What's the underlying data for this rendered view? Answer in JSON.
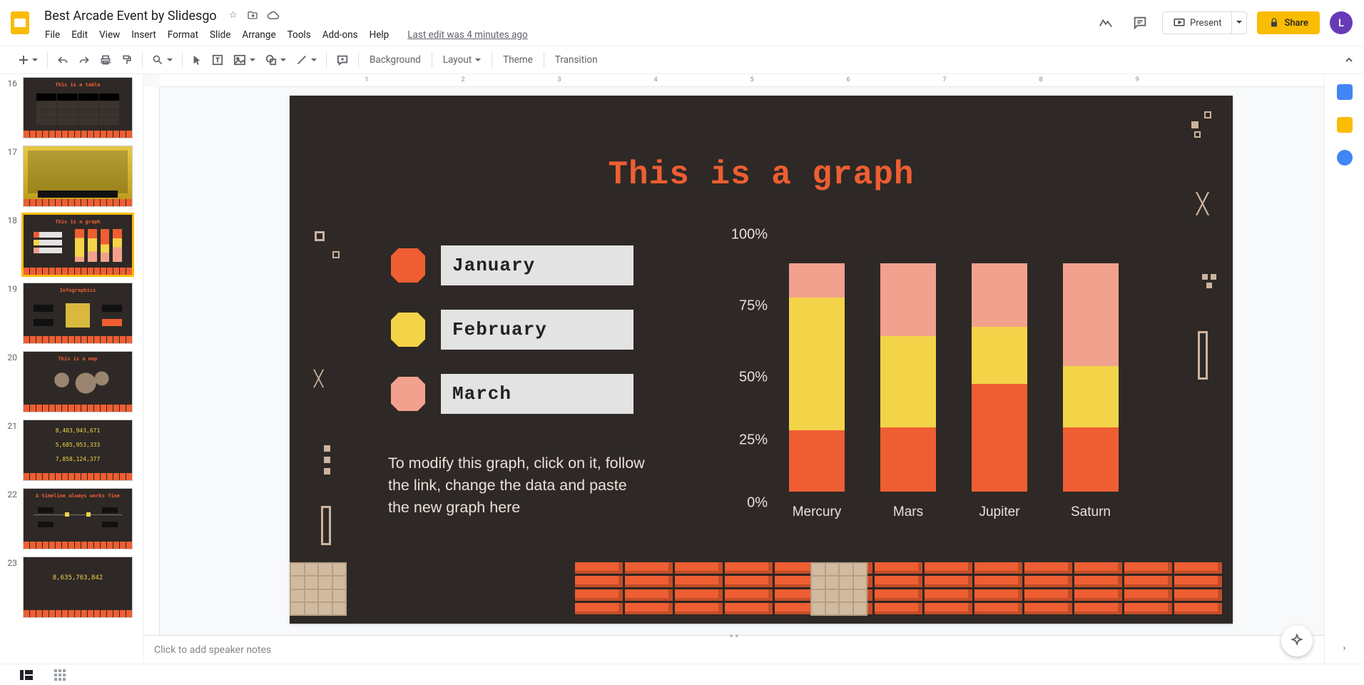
{
  "doc": {
    "name": "Best Arcade Event by Slidesgo",
    "lastEdit": "Last edit was 4 minutes ago",
    "avatarLetter": "L"
  },
  "menu": {
    "file": "File",
    "edit": "Edit",
    "view": "View",
    "insert": "Insert",
    "format": "Format",
    "slide": "Slide",
    "arrange": "Arrange",
    "tools": "Tools",
    "addons": "Add-ons",
    "help": "Help"
  },
  "actions": {
    "present": "Present",
    "share": "Share"
  },
  "toolbar": {
    "background": "Background",
    "layout": "Layout",
    "theme": "Theme",
    "transition": "Transition"
  },
  "filmstrip": {
    "numbers": [
      "16",
      "17",
      "18",
      "19",
      "20",
      "21",
      "22",
      "23"
    ],
    "selectedIndex": 2,
    "thumbTitle16": "This is a table",
    "thumbTitle18": "This is a graph",
    "thumbTitle19": "Infographics",
    "thumbTitle20": "This is a map",
    "thumbTitle22": "A timeline always works fine",
    "thumb21a": "8,403,943,671",
    "thumb21b": "5,685,953,333",
    "thumb21c": "7,858,124,377",
    "thumb23a": "8,635,763,842"
  },
  "slide": {
    "title": "This is a graph",
    "note": "To modify this graph, click on it, follow the link, change the data and paste the new graph here",
    "legend": {
      "jan": "January",
      "feb": "February",
      "mar": "March"
    }
  },
  "chart_data": {
    "type": "bar",
    "stacked": true,
    "ylim": [
      0,
      100
    ],
    "yticks": [
      "0%",
      "25%",
      "50%",
      "75%",
      "100%"
    ],
    "categories": [
      "Mercury",
      "Mars",
      "Jupiter",
      "Saturn"
    ],
    "series": [
      {
        "name": "January",
        "color": "#ee5e32",
        "values": [
          27,
          28,
          47,
          28
        ]
      },
      {
        "name": "February",
        "color": "#f3d449",
        "values": [
          58,
          40,
          25,
          27
        ]
      },
      {
        "name": "March",
        "color": "#f2a18e",
        "values": [
          15,
          32,
          28,
          45
        ]
      }
    ]
  },
  "notes": {
    "placeholder": "Click to add speaker notes"
  },
  "ruler": {
    "nums": [
      "1",
      "2",
      "3",
      "4",
      "5",
      "6",
      "7",
      "8",
      "9"
    ]
  }
}
